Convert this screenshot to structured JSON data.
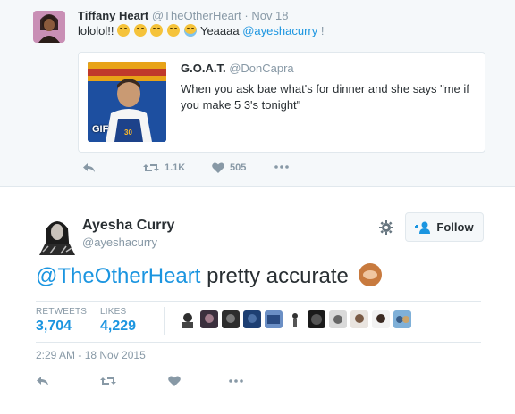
{
  "top_tweet": {
    "name": "Tiffany Heart",
    "handle": "@TheOtherHeart",
    "sep": " · ",
    "date": "Nov 18",
    "text_start": "lololol!! ",
    "text_mid": " Yeaaaa ",
    "mention": "@ayeshacurry",
    "text_end": " !",
    "quoted": {
      "name": "G.O.A.T.",
      "handle": "@DonCapra",
      "text": "When you ask bae what's for dinner and she says \"me if you make 5 3's tonight\"",
      "media_badge": "GIF"
    },
    "actions": {
      "retweets": "1.1K",
      "likes": "505"
    }
  },
  "main_tweet": {
    "name": "Ayesha Curry",
    "handle": "@ayeshacurry",
    "follow_label": "Follow",
    "mention": "@TheOtherHeart",
    "text": " pretty accurate ",
    "stats": {
      "retweets_label": "RETWEETS",
      "retweets_value": "3,704",
      "likes_label": "LIKES",
      "likes_value": "4,229"
    },
    "timestamp": "2:29 AM - 18 Nov 2015"
  },
  "colors": {
    "accent": "#1b95e0",
    "muted": "#8899a6",
    "text": "#292f33",
    "border": "#e1e8ed",
    "top_bg": "#f5f8fa"
  },
  "icons": [
    "reply-icon",
    "retweet-icon",
    "heart-icon",
    "more-icon",
    "gear-icon",
    "follow-person-icon",
    "monkey-emoji",
    "laughing-emoji"
  ]
}
